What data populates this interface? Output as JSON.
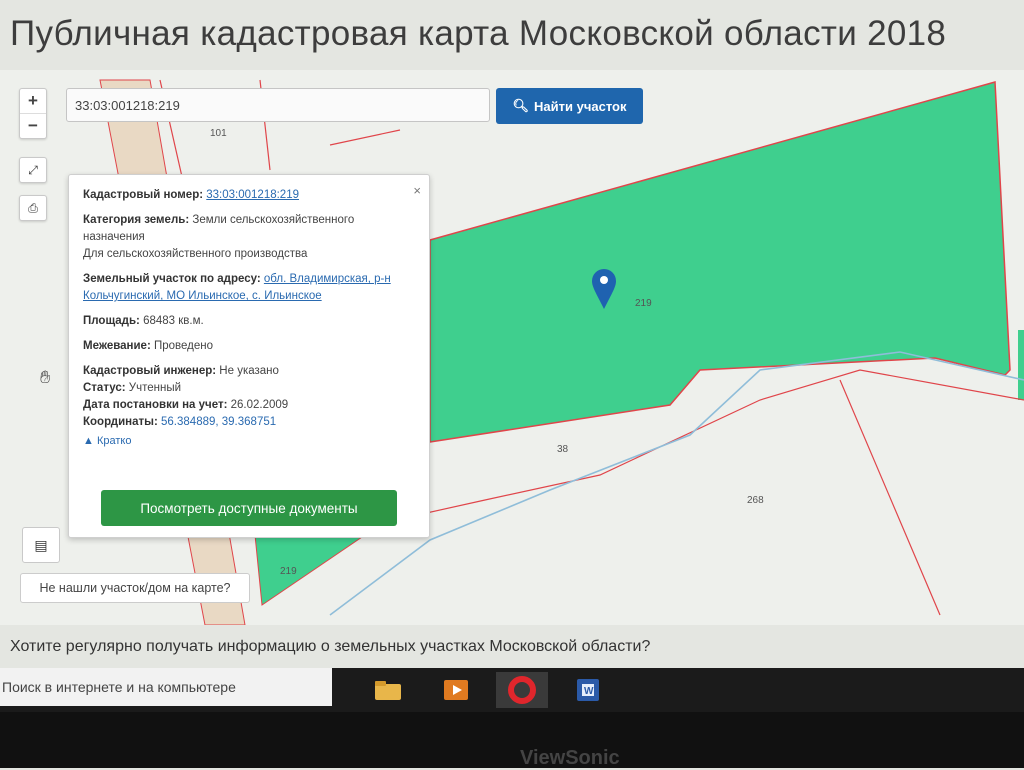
{
  "page": {
    "title": "Публичная кадастровая карта Московской области 2018"
  },
  "search": {
    "value": "33:03:001218:219",
    "button_label": "Найти участок",
    "button_icon": "search-icon"
  },
  "controls": {
    "zoom_in": "+",
    "zoom_out": "−",
    "fullscreen_icon": "expand-icon",
    "print_icon": "printer-icon",
    "layers_icon": "layers-icon"
  },
  "map": {
    "plot_labels": [
      "101",
      "219",
      "38",
      "268",
      "219"
    ],
    "colors": {
      "plot_fill": "#3fcf8e",
      "boundary": "#e0454a",
      "river": "#8fbdd9",
      "marker": "#1f62b0"
    }
  },
  "popup": {
    "cadastral_label": "Кадастровый номер:",
    "cadastral_value": "33:03:001218:219",
    "category_label": "Категория земель:",
    "category_value": "Земли сельскохозяйственного назначения",
    "usage_value": "Для сельскохозяйственного производства",
    "address_label": "Земельный участок по адресу:",
    "address_value": "обл. Владимирская, р-н Кольчугинский, МО Ильинское, с. Ильинское",
    "area_label": "Площадь:",
    "area_value": "68483 кв.м.",
    "survey_label": "Межевание:",
    "survey_value": "Проведено",
    "engineer_label": "Кадастровый инженер:",
    "engineer_value": "Не указано",
    "status_label": "Статус:",
    "status_value": "Учтенный",
    "date_label": "Дата постановки на учет:",
    "date_value": "26.02.2009",
    "coords_label": "Координаты:",
    "coords_value": "56.384889, 39.368751",
    "brief_label": "Кратко",
    "docs_button": "Посмотреть доступные документы",
    "close": "×"
  },
  "not_found_button": "Не нашли участок/дом на карте?",
  "question_text": "Хотите регулярно получать информацию о земельных участках Московской области?",
  "taskbar": {
    "search_text": "Поиск в интернете и на компьютере",
    "apps": [
      "folder-icon",
      "media-player-icon",
      "opera-icon",
      "word-icon"
    ]
  },
  "monitor_brand": "ViewSonic"
}
